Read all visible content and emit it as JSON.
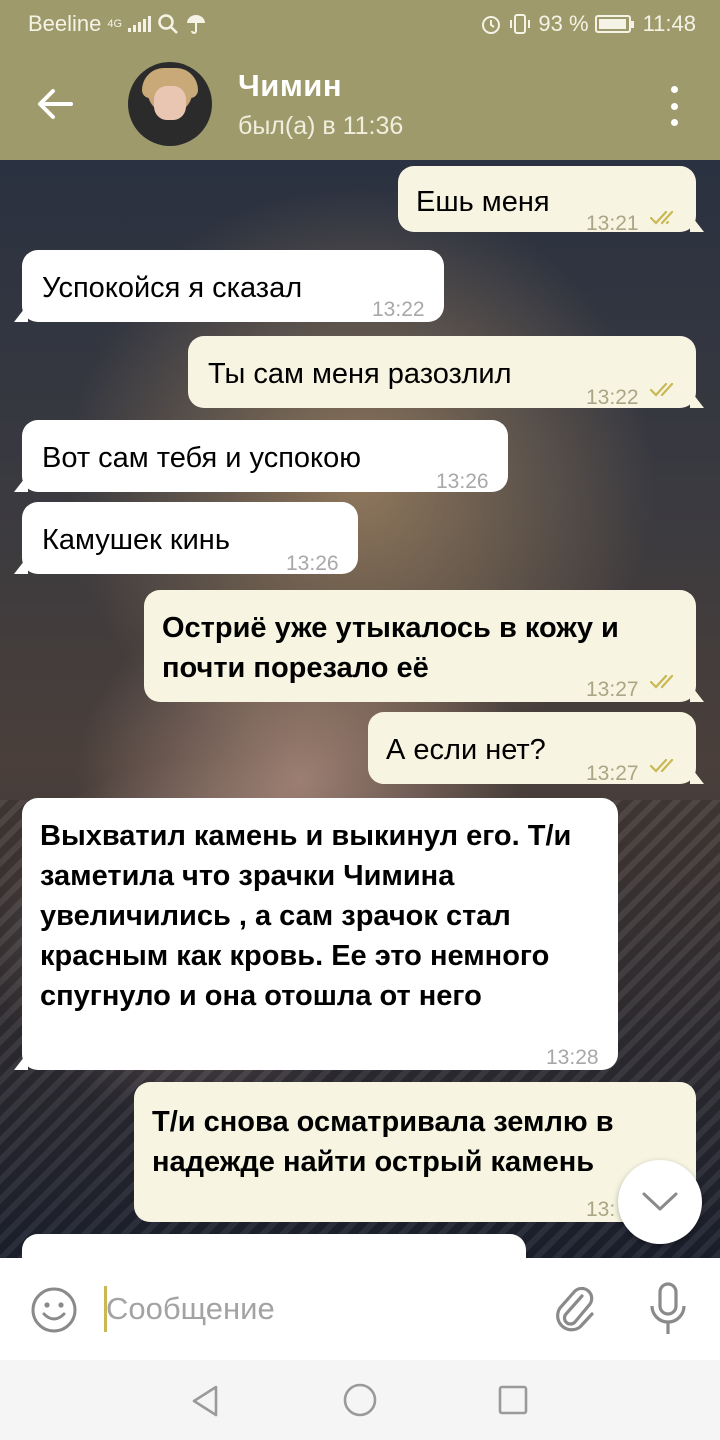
{
  "status_bar": {
    "carrier": "Beeline",
    "network": "4G",
    "battery": "93 %",
    "time": "11:48"
  },
  "header": {
    "contact_name": "Чимин",
    "last_seen": "был(а) в 11:36"
  },
  "messages": [
    {
      "dir": "out",
      "text": "Ешь меня",
      "time": "13:21",
      "read": true
    },
    {
      "dir": "in",
      "text": "Успокойся я сказал",
      "time": "13:22"
    },
    {
      "dir": "out",
      "text": "Ты сам меня разозлил",
      "time": "13:22",
      "read": true
    },
    {
      "dir": "in",
      "text": "Вот сам тебя и успокою",
      "time": "13:26"
    },
    {
      "dir": "in",
      "text": "Камушек кинь",
      "time": "13:26"
    },
    {
      "dir": "out",
      "text": "Остриё уже утыкалось в кожу и почти порезало её",
      "time": "13:27",
      "read": true
    },
    {
      "dir": "out",
      "text": "А если нет?",
      "time": "13:27",
      "read": true
    },
    {
      "dir": "in",
      "text": "Выхватил камень и выкинул его. Т/и заметила что зрачки Чимина увеличились , а сам зрачок стал красным как кровь. Ее это немного спугнуло и она отошла от него",
      "time": "13:28"
    },
    {
      "dir": "out",
      "text": "Т/и снова осматривала землю в надежде найти острый камень",
      "time": "13:"
    }
  ],
  "input": {
    "placeholder": "Сообщение"
  },
  "colors": {
    "header": "#9e9a6c",
    "outgoing_bubble": "#f7f5e1",
    "incoming_bubble": "#ffffff",
    "read_ticks": "#c9b855"
  }
}
